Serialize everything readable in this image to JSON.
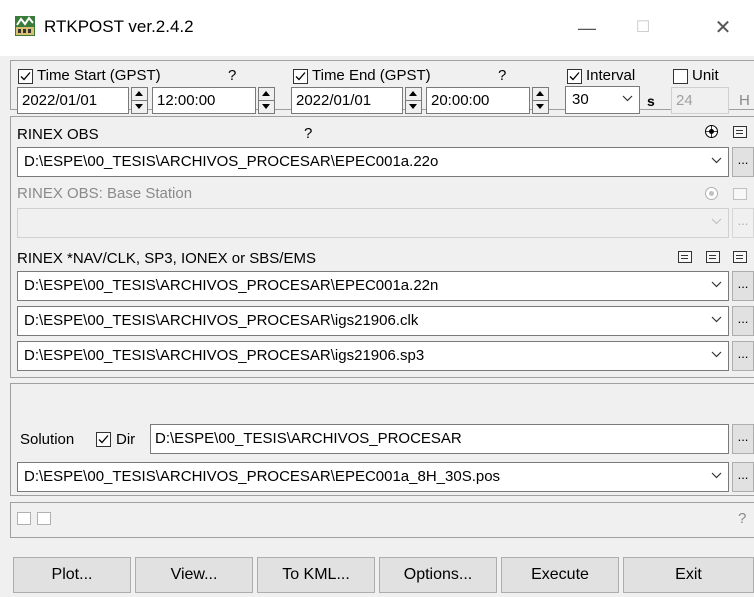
{
  "window": {
    "title": "RTKPOST ver.2.4.2",
    "controls": {
      "minimize": "—",
      "maximize": "☐",
      "close": "✕"
    }
  },
  "time": {
    "start_label": "Time Start (GPST)",
    "start_help": "?",
    "start_date": "2022/01/01",
    "start_time": "12:00:00",
    "end_label": "Time End (GPST)",
    "end_help": "?",
    "end_date": "2022/01/01",
    "end_time": "20:00:00",
    "interval_label": "Interval",
    "interval_value": "30",
    "interval_unit": "s",
    "unit_label": "Unit",
    "unit_value": "24",
    "unit_suffix": "H"
  },
  "rinex_obs": {
    "label": "RINEX OBS",
    "help": "?",
    "rover_file": "D:\\ESPE\\00_TESIS\\ARCHIVOS_PROCESAR\\EPEC001a.22o",
    "base_label": "RINEX OBS: Base Station",
    "base_file": ""
  },
  "nav": {
    "label": "RINEX *NAV/CLK, SP3, IONEX or SBS/EMS",
    "files": [
      "D:\\ESPE\\00_TESIS\\ARCHIVOS_PROCESAR\\EPEC001a.22n",
      "D:\\ESPE\\00_TESIS\\ARCHIVOS_PROCESAR\\igs21906.clk",
      "D:\\ESPE\\00_TESIS\\ARCHIVOS_PROCESAR\\igs21906.sp3"
    ]
  },
  "solution": {
    "label": "Solution",
    "dir_label": "Dir",
    "dir_value": "D:\\ESPE\\00_TESIS\\ARCHIVOS_PROCESAR",
    "output_file": "D:\\ESPE\\00_TESIS\\ARCHIVOS_PROCESAR\\EPEC001a_8H_30S.pos"
  },
  "status": {
    "help": "?"
  },
  "ellipsis": "...",
  "buttons": {
    "plot": "Plot...",
    "view": "View...",
    "to_kml": "To KML...",
    "options": "Options...",
    "execute": "Execute",
    "exit": "Exit"
  }
}
